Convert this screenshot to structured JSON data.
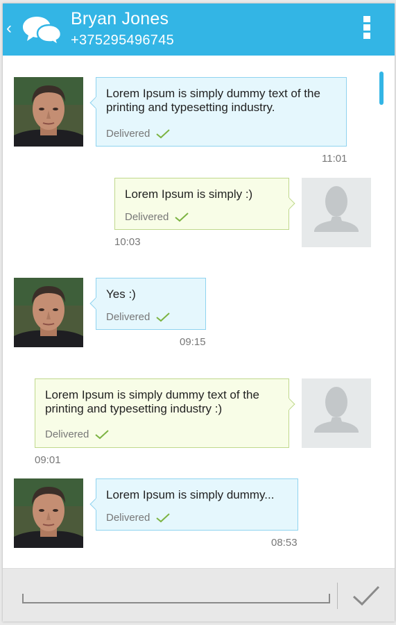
{
  "header": {
    "contact_name": "Bryan Jones",
    "contact_phone": "+375295496745",
    "back_icon": "chevron-left-icon",
    "chat_icon": "chat-bubbles-icon",
    "menu_icon": "overflow-menu-icon",
    "background_color": "#33b5e5"
  },
  "messages": [
    {
      "direction": "incoming",
      "text": "Lorem Ipsum is simply dummy text of the printing and typesetting industry.",
      "status": "Delivered",
      "time": "11:01"
    },
    {
      "direction": "outgoing",
      "text": "Lorem Ipsum is simply :)",
      "status": "Delivered",
      "time": "10:03"
    },
    {
      "direction": "incoming",
      "text": "Yes :)",
      "status": "Delivered",
      "time": "09:15"
    },
    {
      "direction": "outgoing",
      "text": "Lorem Ipsum is simply dummy text of the printing and typesetting industry :)",
      "status": "Delivered",
      "time": "09:01"
    },
    {
      "direction": "incoming",
      "text": "Lorem Ipsum is simply dummy...",
      "status": "Delivered",
      "time": "08:53"
    }
  ],
  "colors": {
    "incoming_bubble": "#e5f7fd",
    "outgoing_bubble": "#f8fde7",
    "check_mark": "#7cb342"
  },
  "compose": {
    "input_value": "",
    "send_icon": "checkmark-icon"
  }
}
